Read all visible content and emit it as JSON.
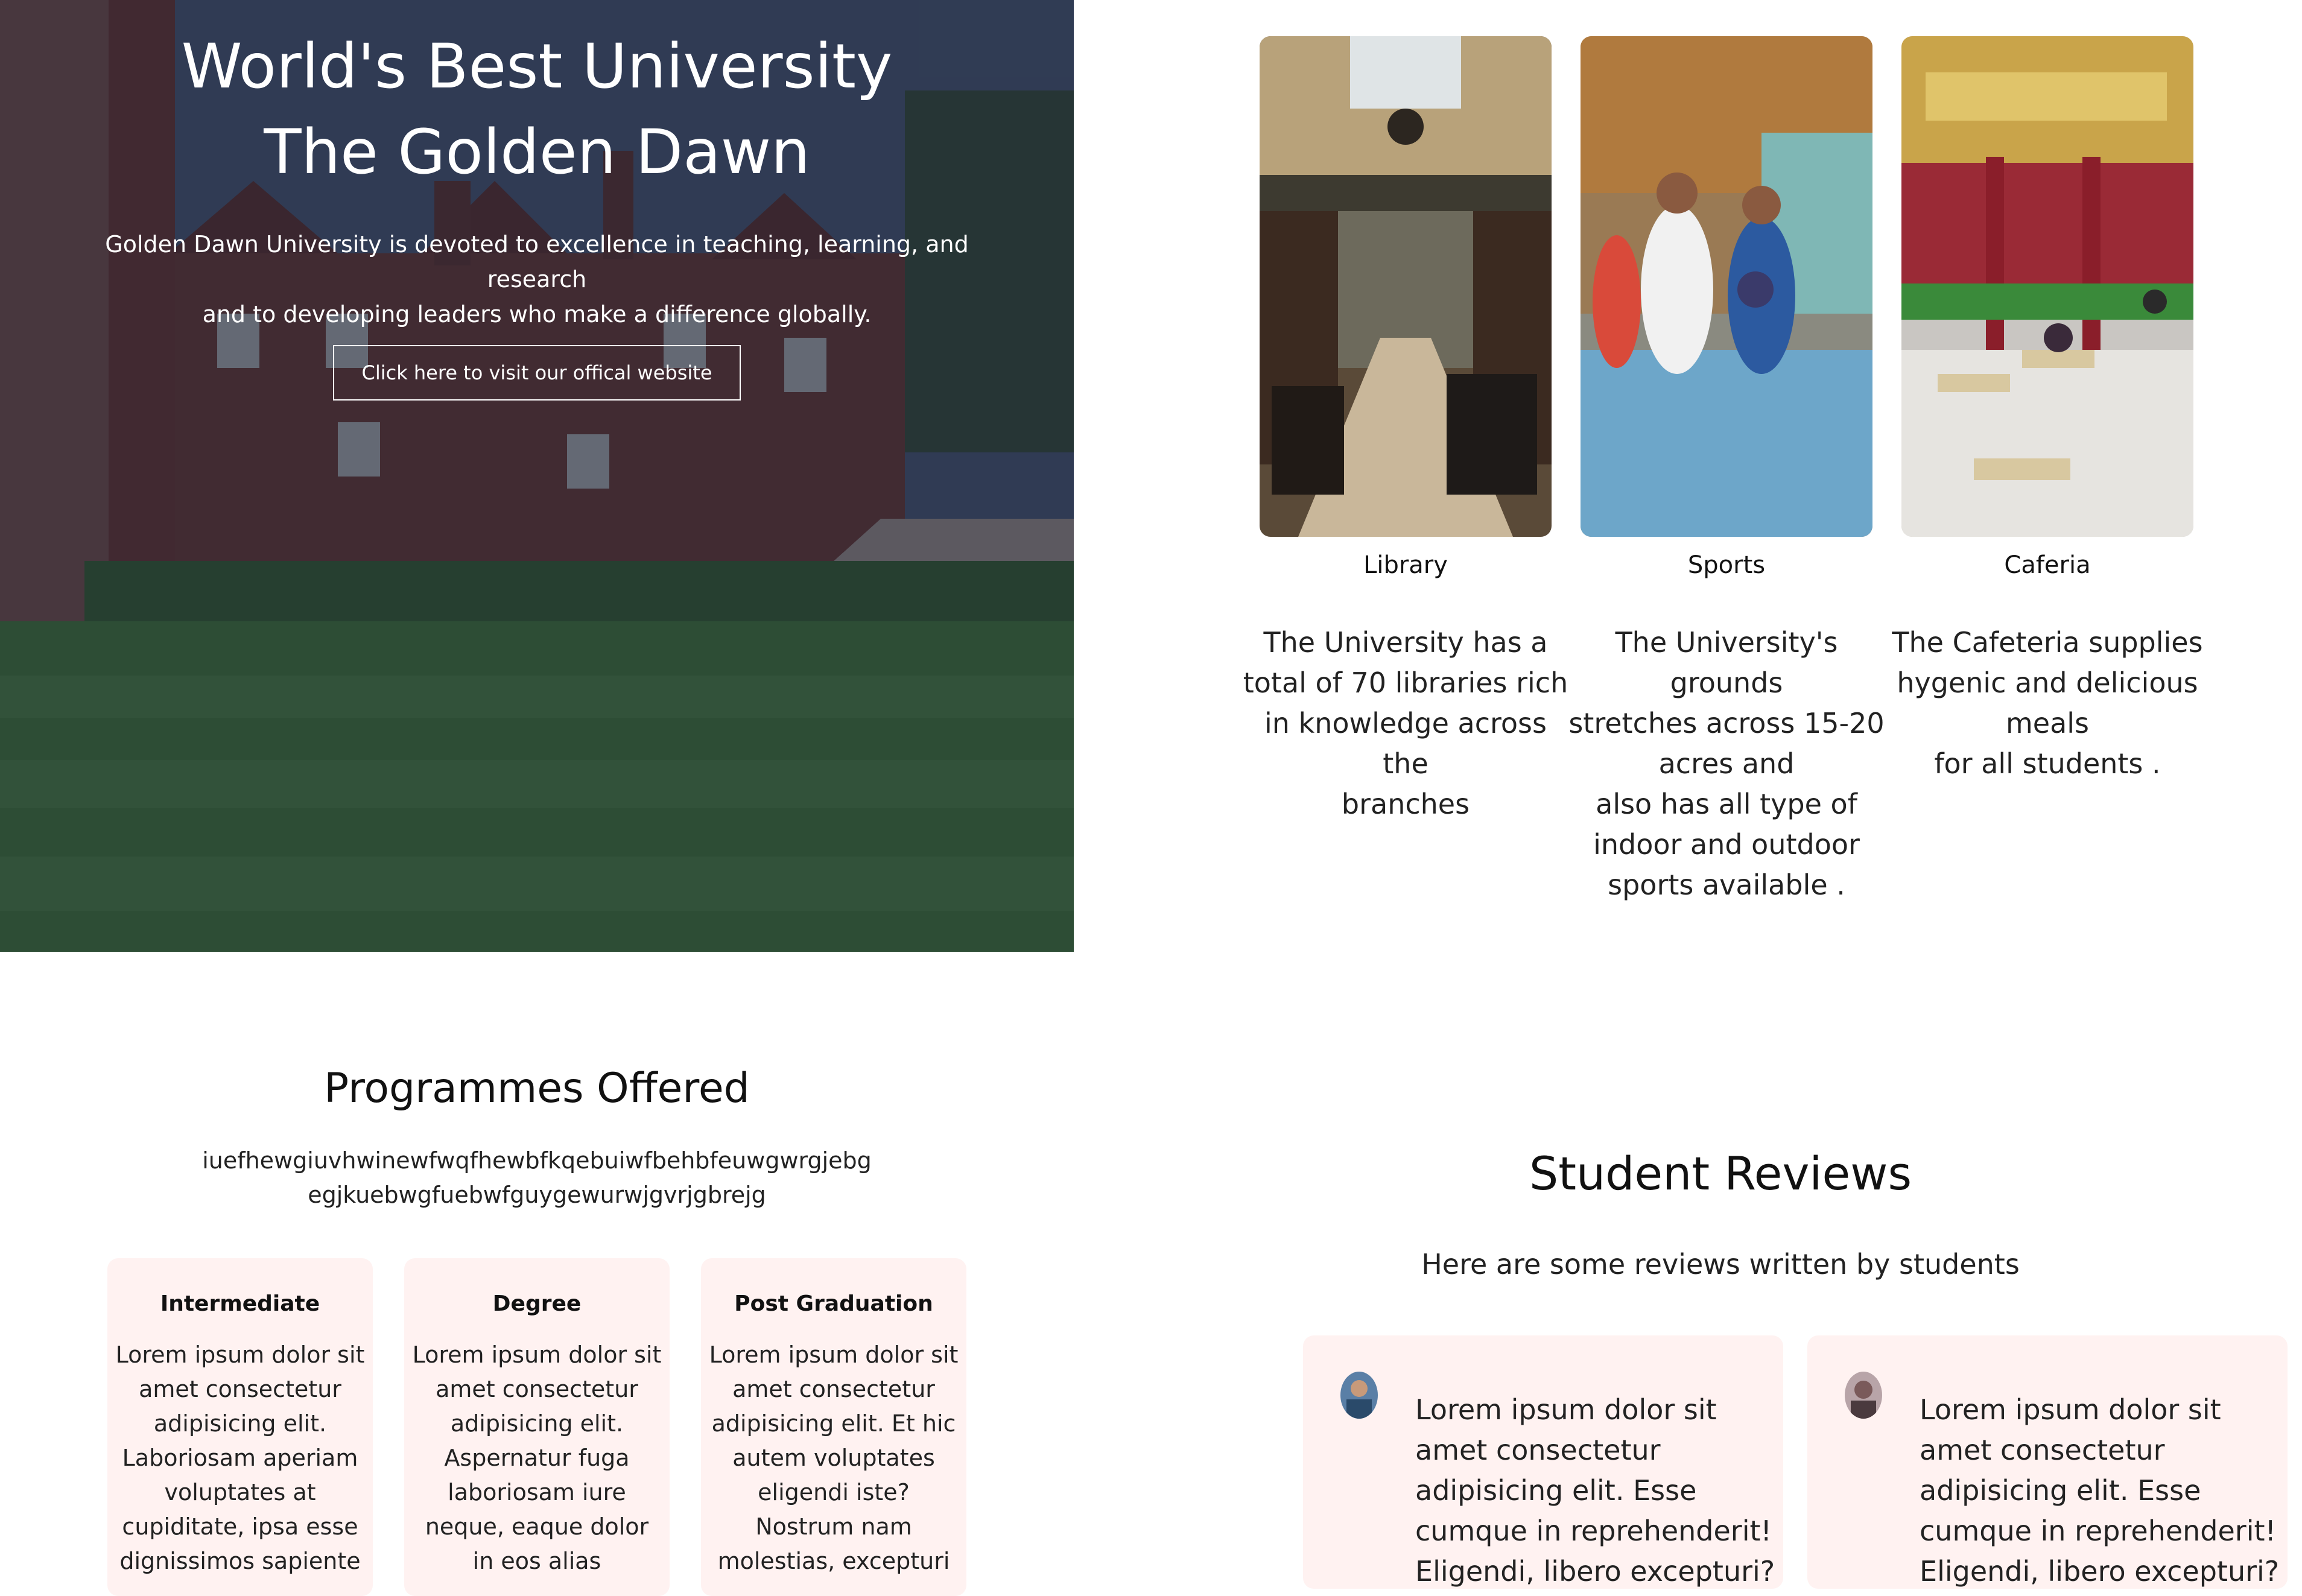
{
  "hero": {
    "title_lines": [
      "World's Best University",
      "The Golden Dawn"
    ],
    "description_lines": [
      "Golden Dawn University is devoted to excellence in teaching, learning, and research",
      "and to developing leaders who make a difference globally."
    ],
    "button_label": "Click here to visit our offical website"
  },
  "facilities": [
    {
      "name": "Library",
      "description_lines": [
        "The University has a",
        "total of 70 libraries rich",
        "in knowledge across the",
        "branches"
      ]
    },
    {
      "name": "Sports",
      "description_lines": [
        "The University's grounds",
        "stretches across 15-20",
        "acres and",
        "also has all type of",
        "indoor and outdoor",
        "sports available ."
      ]
    },
    {
      "name": "Caferia",
      "description_lines": [
        "The Cafeteria supplies",
        "hygenic and delicious",
        "meals",
        "for all students ."
      ]
    }
  ],
  "programmes": {
    "title": "Programmes Offered",
    "subtitle_lines": [
      "iuefhewgiuvhwinewfwqfhewbfkqebuiwfbehbfeuwgwrgjebg",
      "egjkuebwgfuebwfguygewurwjgvrjgbrejg"
    ],
    "cards": [
      {
        "title": "Intermediate",
        "text_lines": [
          "Lorem ipsum dolor sit",
          "amet consectetur",
          "adipisicing elit.",
          "Laboriosam aperiam",
          "voluptates at",
          "cupiditate, ipsa esse",
          "dignissimos sapiente"
        ]
      },
      {
        "title": "Degree",
        "text_lines": [
          "Lorem ipsum dolor sit",
          "amet consectetur",
          "adipisicing elit.",
          "Aspernatur fuga",
          "laboriosam iure",
          "neque, eaque dolor",
          "in eos alias"
        ]
      },
      {
        "title": "Post Graduation",
        "text_lines": [
          "Lorem ipsum dolor sit",
          "amet consectetur",
          "adipisicing elit. Et hic",
          "autem voluptates",
          "eligendi iste?",
          "Nostrum nam",
          "molestias, excepturi"
        ]
      }
    ]
  },
  "reviews": {
    "title": "Student Reviews",
    "subtitle": "Here are some reviews written by students",
    "cards": [
      {
        "text_lines": [
          "Lorem ipsum dolor sit",
          "amet consectetur",
          "adipisicing elit. Esse",
          "cumque in reprehenderit!",
          "Eligendi, libero excepturi?"
        ]
      },
      {
        "text_lines": [
          "Lorem ipsum dolor sit",
          "amet consectetur",
          "adipisicing elit. Esse",
          "cumque in reprehenderit!",
          "Eligendi, libero excepturi?"
        ]
      }
    ]
  },
  "colors": {
    "hero_overlay": "#121c34",
    "card_background": "#fff2f1",
    "text_primary": "#111111",
    "hero_text": "#ffffff"
  }
}
